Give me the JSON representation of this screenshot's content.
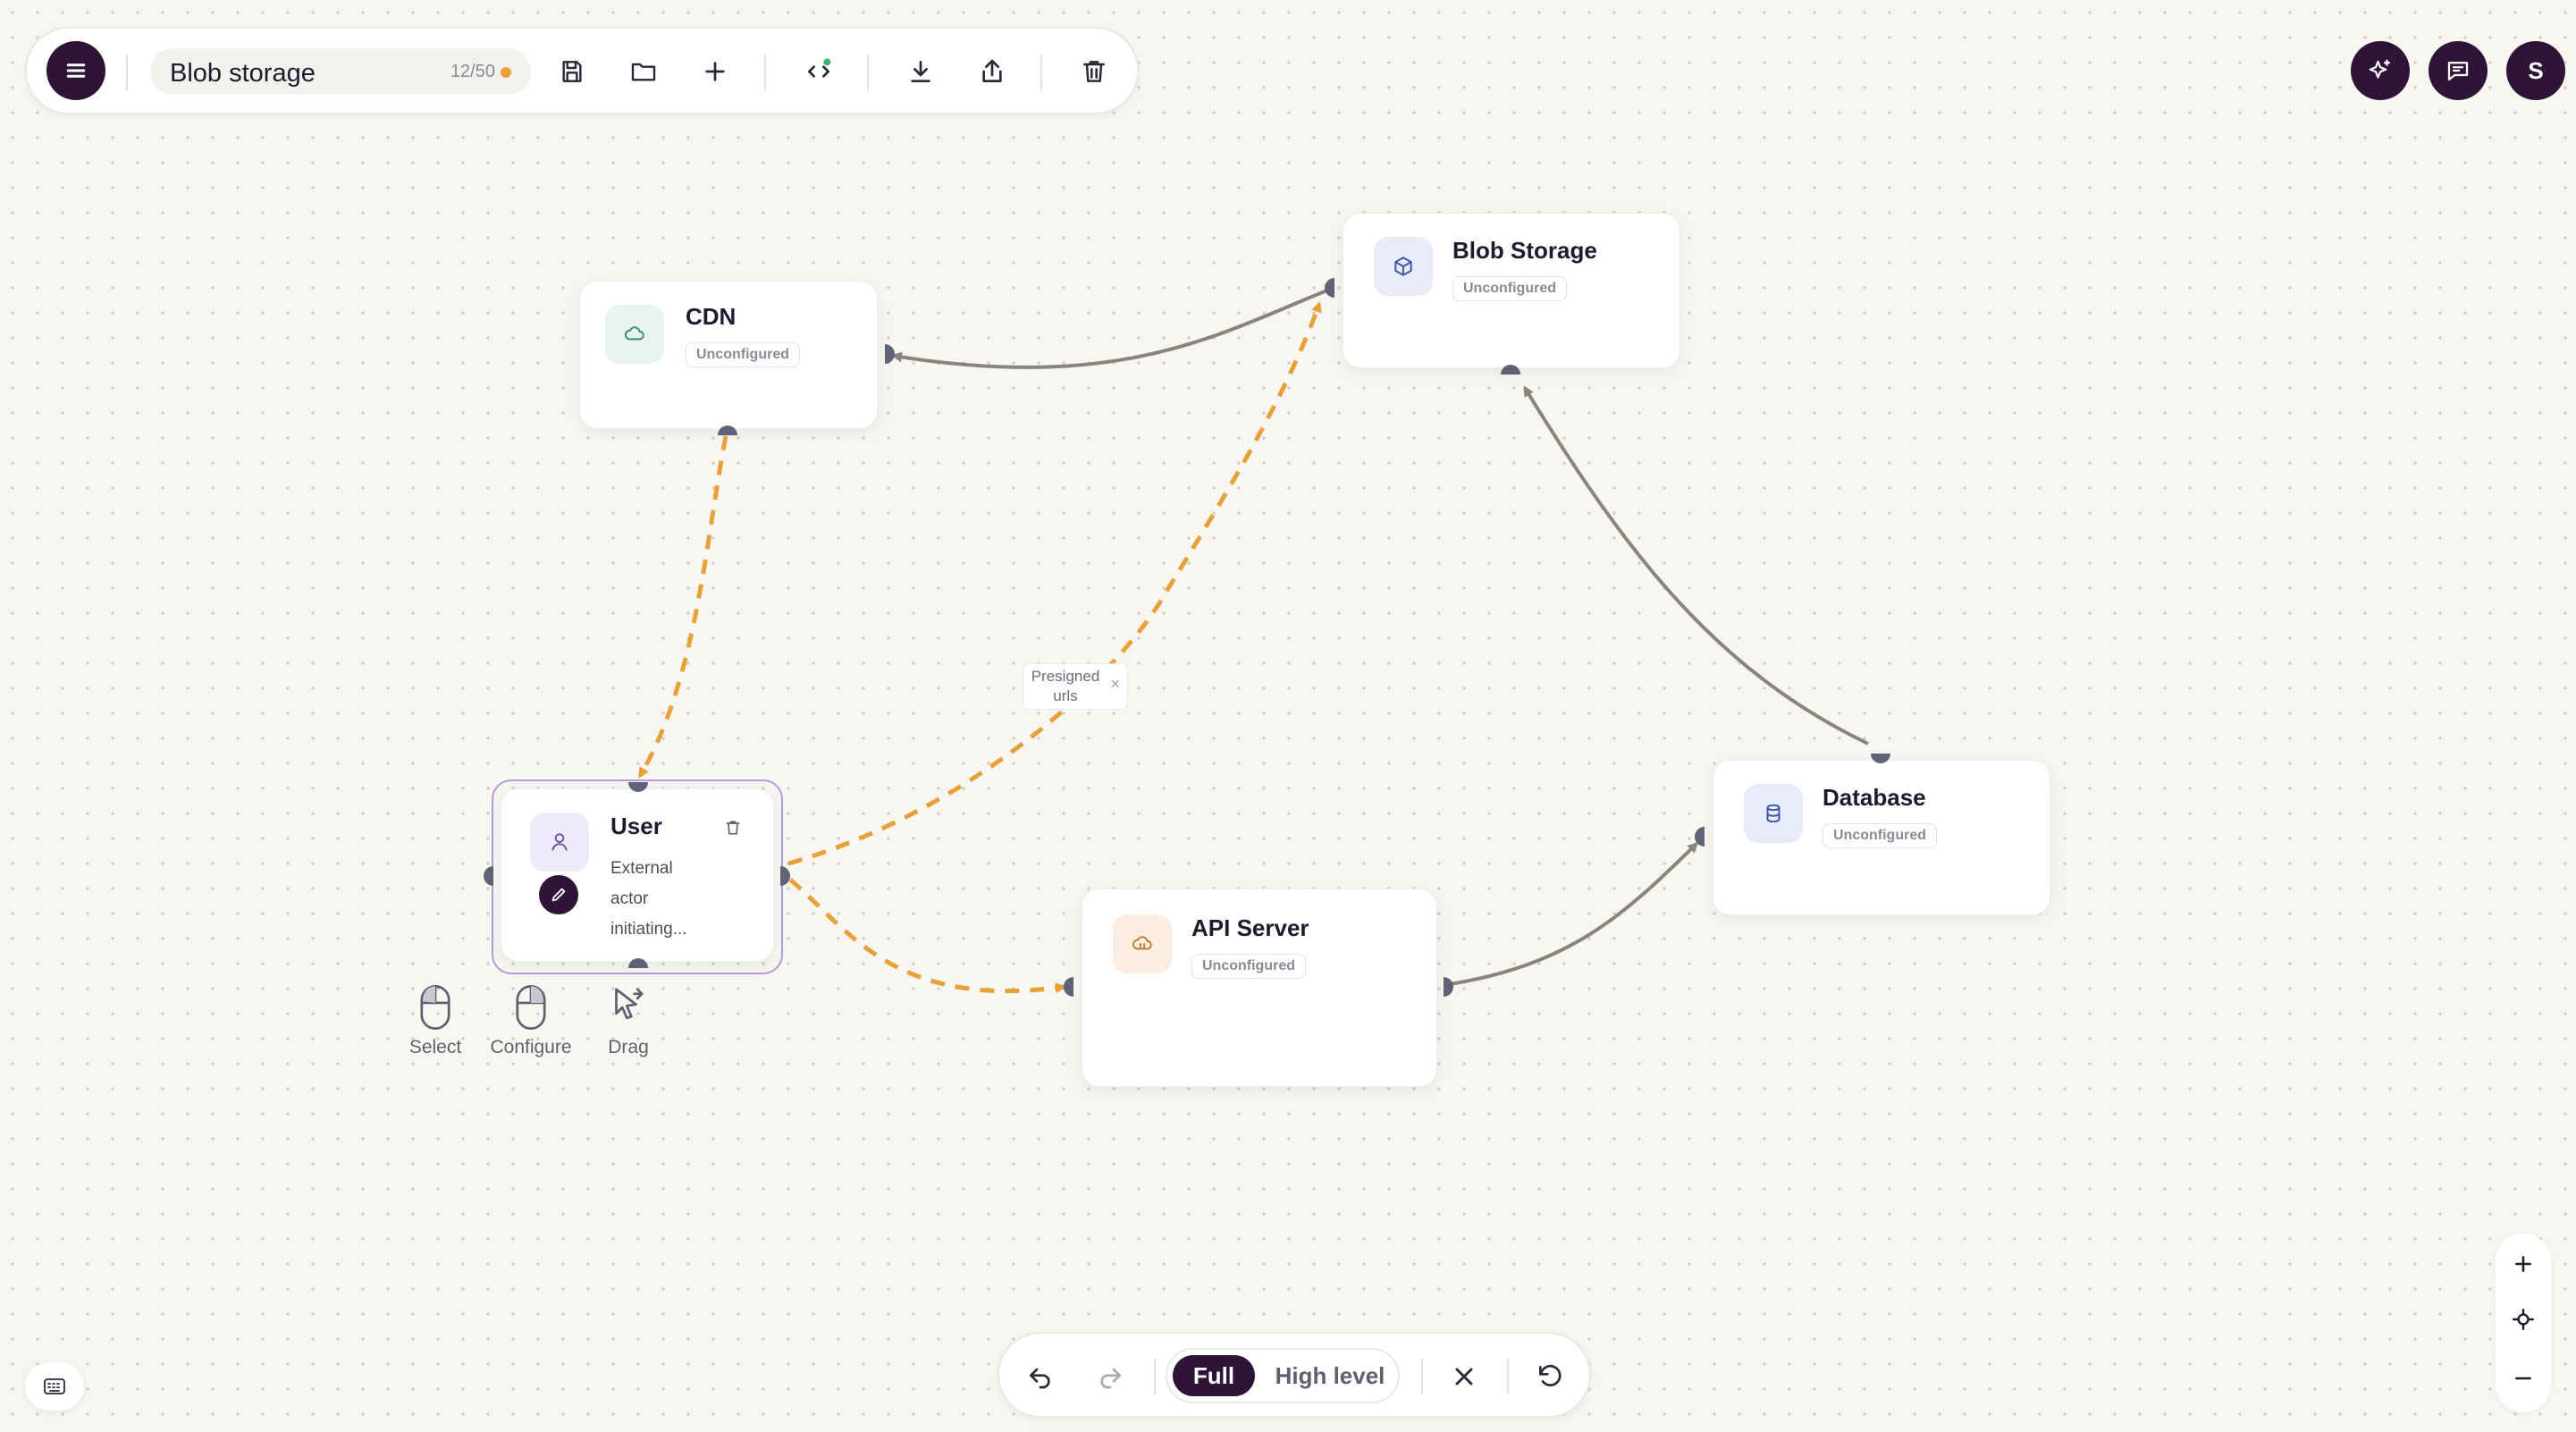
{
  "toolbar": {
    "title": "Blob storage",
    "node_count": "12/50",
    "status_dot_color": "#e8a13a",
    "icons": [
      "menu-icon",
      "save-icon",
      "folder-icon",
      "add-icon",
      "code-icon",
      "download-icon",
      "share-icon",
      "trash-icon"
    ]
  },
  "top_right": {
    "avatar_initial": "S",
    "icons": [
      "ai-sparkle-icon",
      "chat-icon"
    ]
  },
  "nodes": {
    "cdn": {
      "title": "CDN",
      "badge": "Unconfigured",
      "icon": "cloud-icon"
    },
    "blob": {
      "title": "Blob Storage",
      "badge": "Unconfigured",
      "icon": "box-icon"
    },
    "user": {
      "title": "User",
      "description": "External actor initiating...",
      "desc_lines": [
        "External",
        "actor",
        "initiating..."
      ],
      "icon": "user-icon"
    },
    "api": {
      "title": "API Server",
      "badge": "Unconfigured",
      "icon": "server-icon"
    },
    "database": {
      "title": "Database",
      "badge": "Unconfigured",
      "icon": "database-icon"
    }
  },
  "edge_label": {
    "line1": "Presigned",
    "line2": "urls",
    "close": "×"
  },
  "hints": {
    "select": "Select",
    "configure": "Configure",
    "drag": "Drag"
  },
  "bottom_bar": {
    "mode_full": "Full",
    "mode_high": "High level",
    "active_mode": "Full"
  },
  "colors": {
    "accent": "#2e1437",
    "dashed_edge": "#e8a13a",
    "solid_edge": "#8a857c",
    "selection": "#b79bdc"
  }
}
